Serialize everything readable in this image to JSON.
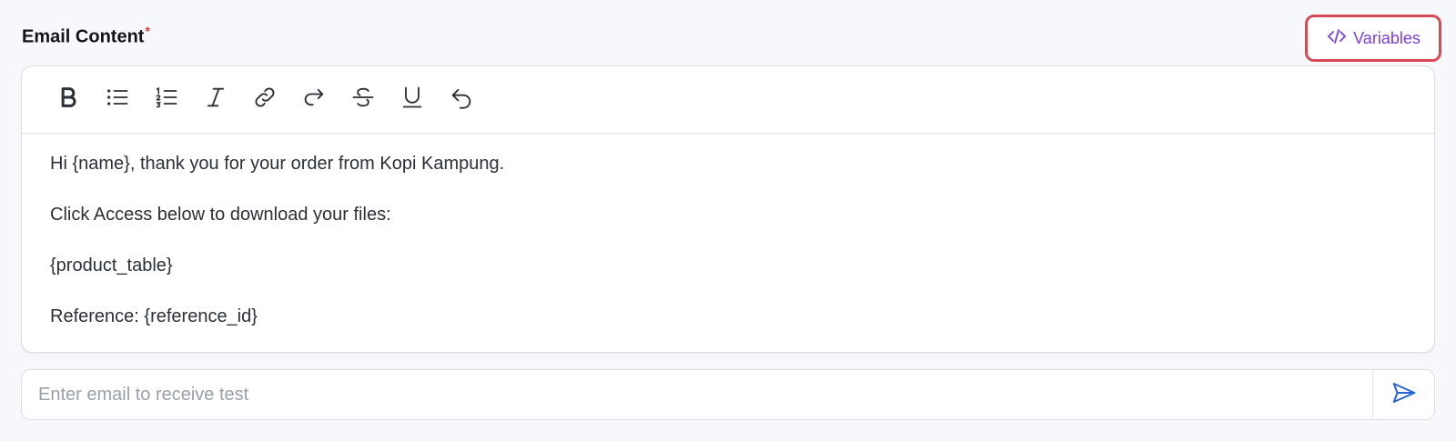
{
  "section": {
    "label": "Email Content",
    "required_mark": "*"
  },
  "variables_button": {
    "label": "Variables",
    "icon": "code-icon",
    "accent_color": "#7a3ee0",
    "highlight_border": "#d54a55"
  },
  "toolbar": {
    "tools": [
      {
        "name": "bold",
        "icon": "bold-icon"
      },
      {
        "name": "bullet-list",
        "icon": "bullet-list-icon"
      },
      {
        "name": "numbered-list",
        "icon": "numbered-list-icon"
      },
      {
        "name": "italic",
        "icon": "italic-icon"
      },
      {
        "name": "link",
        "icon": "link-icon"
      },
      {
        "name": "redo",
        "icon": "redo-icon"
      },
      {
        "name": "strikethrough",
        "icon": "strikethrough-icon"
      },
      {
        "name": "underline",
        "icon": "underline-icon"
      },
      {
        "name": "undo",
        "icon": "undo-icon"
      }
    ]
  },
  "editor": {
    "lines": [
      "Hi {name}, thank you for your order from Kopi Kampung.",
      "Click Access below to download your files:",
      "{product_table}",
      "Reference: {reference_id}"
    ]
  },
  "test_email": {
    "placeholder": "Enter email to receive test",
    "value": "",
    "send_icon": "send-icon",
    "send_color": "#2563d9"
  }
}
